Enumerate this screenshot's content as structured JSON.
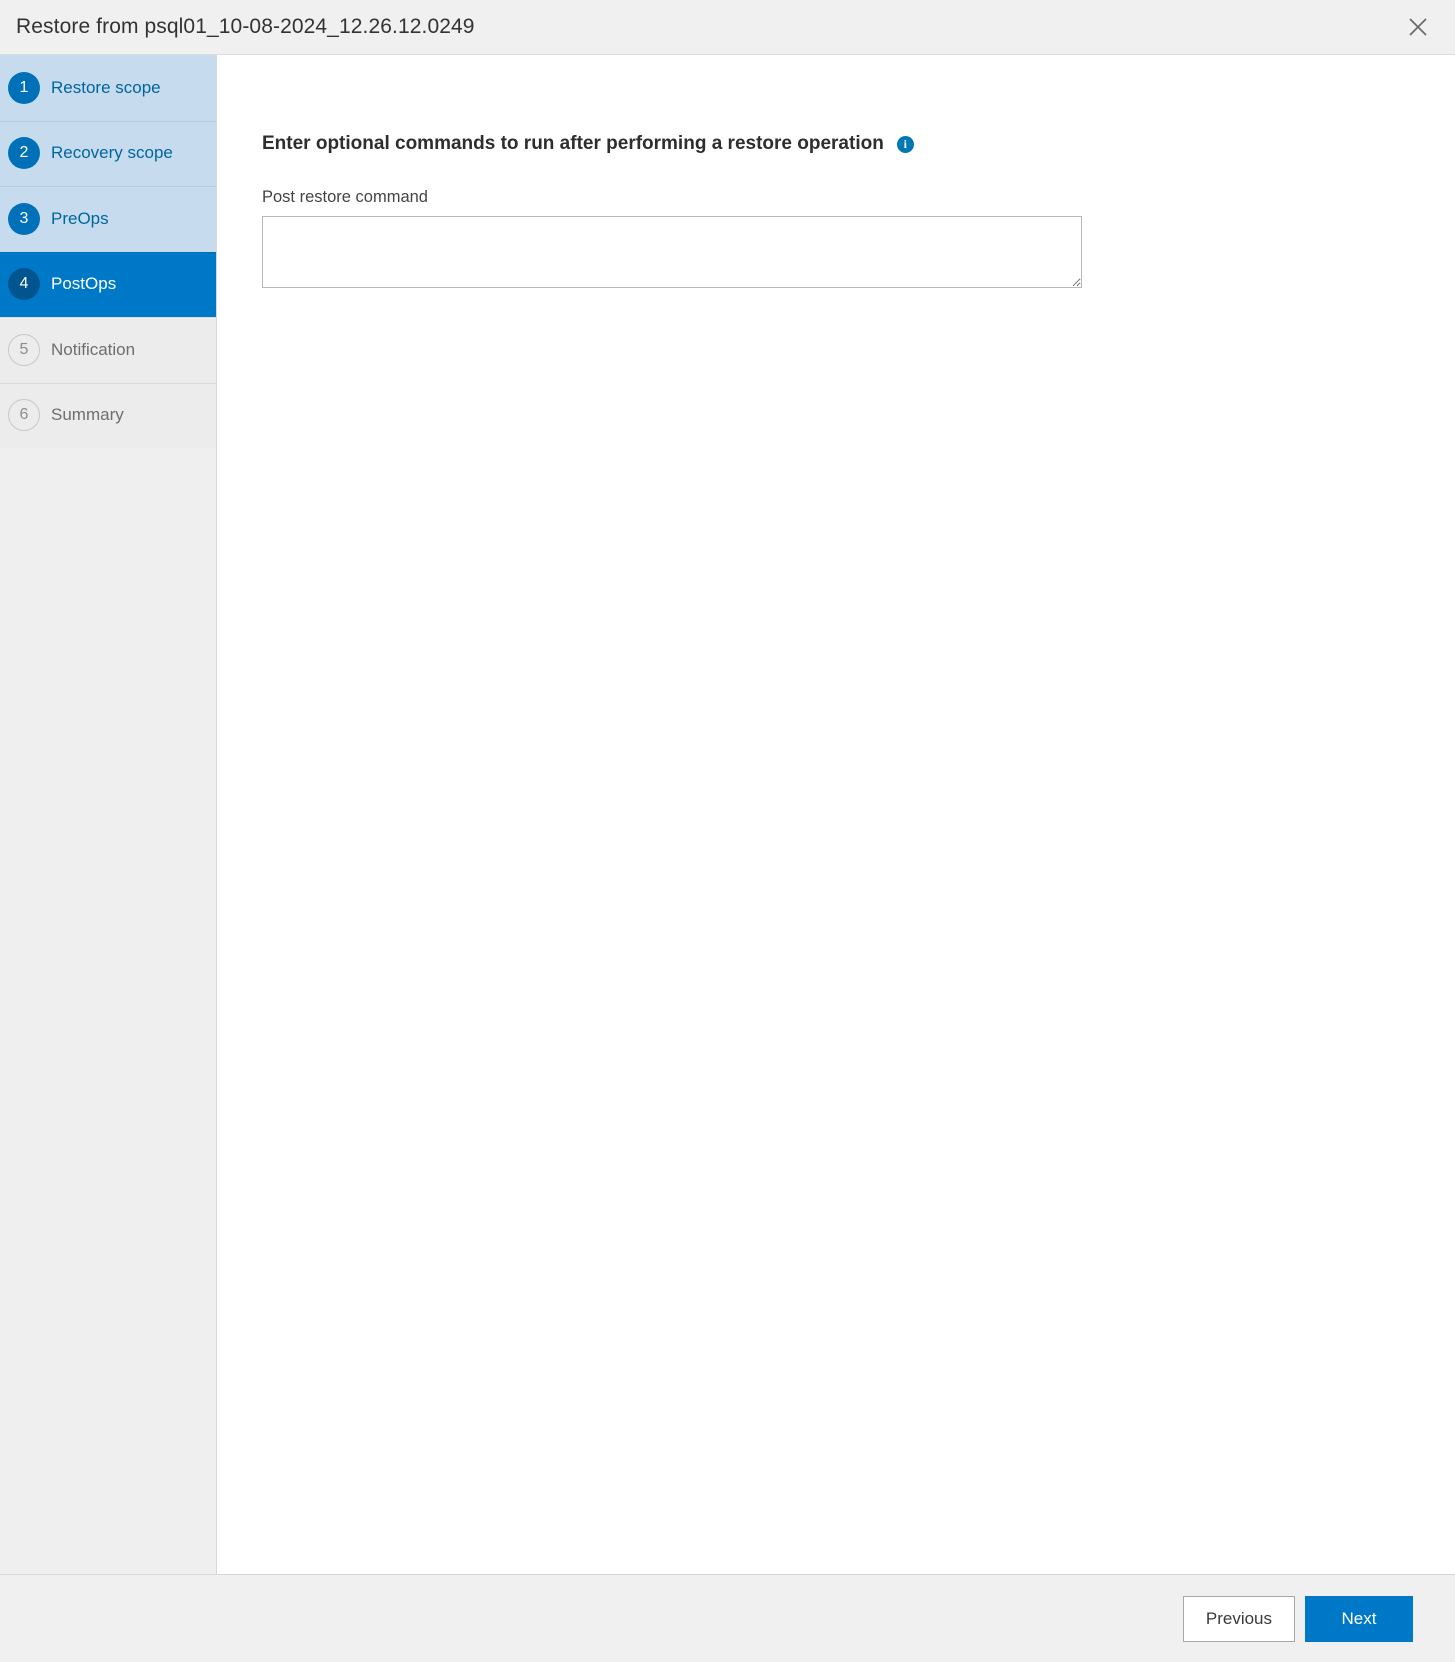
{
  "dialog": {
    "title": "Restore from psql01_10-08-2024_12.26.12.0249",
    "close_icon": "close-icon"
  },
  "sidebar": {
    "items": [
      {
        "num": "1",
        "label": "Restore scope",
        "state": "completed"
      },
      {
        "num": "2",
        "label": "Recovery scope",
        "state": "completed"
      },
      {
        "num": "3",
        "label": "PreOps",
        "state": "completed"
      },
      {
        "num": "4",
        "label": "PostOps",
        "state": "active"
      },
      {
        "num": "5",
        "label": "Notification",
        "state": "pending"
      },
      {
        "num": "6",
        "label": "Summary",
        "state": "pending"
      }
    ]
  },
  "main": {
    "heading": "Enter optional commands to run after performing a restore operation",
    "info_icon": "info-icon",
    "info_glyph": "i",
    "field_label": "Post restore command",
    "field_value": "",
    "field_placeholder": ""
  },
  "footer": {
    "previous_label": "Previous",
    "next_label": "Next"
  },
  "colors": {
    "accent": "#0078c8",
    "completed_bg": "#c6dcee",
    "completed_circle": "#0070b8",
    "active_circle": "#00558f",
    "pending_bg": "#ececec",
    "header_bg": "#f0f0f0",
    "info_blue": "#0078b4"
  }
}
